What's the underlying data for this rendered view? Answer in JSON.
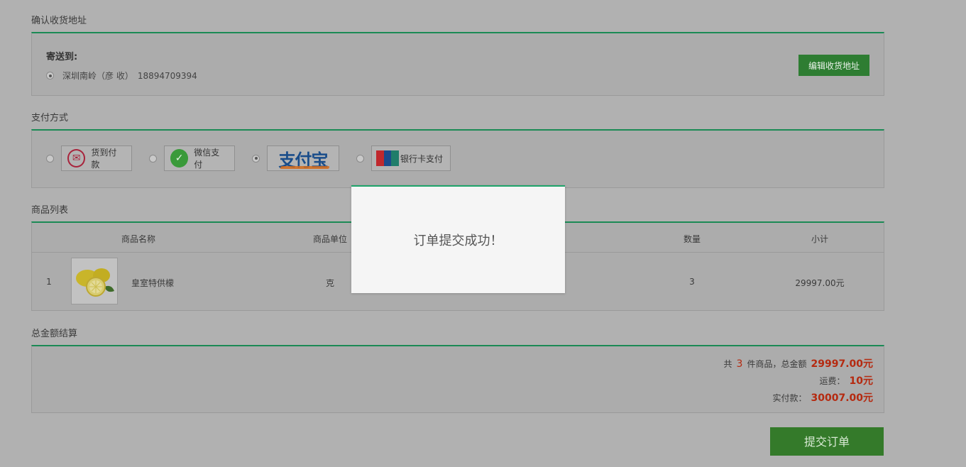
{
  "address_section": {
    "title": "确认收货地址",
    "send_to_label": "寄送到:",
    "address_text": "深圳南岭（彦 收）",
    "phone": "18894709394",
    "edit_button": "编辑收货地址"
  },
  "payment_section": {
    "title": "支付方式",
    "options": [
      {
        "label": "货到付款",
        "icon": "cash-on-delivery-icon",
        "selected": false
      },
      {
        "label": "微信支付",
        "icon": "wechat-pay-icon",
        "selected": false
      },
      {
        "label": "支付宝",
        "icon": "alipay-logo",
        "selected": true
      },
      {
        "label": "银行卡支付",
        "icon": "unionpay-icon",
        "selected": false
      }
    ]
  },
  "product_section": {
    "title": "商品列表",
    "columns": [
      "商品名称",
      "商品单位",
      "数量",
      "小计"
    ],
    "rows": [
      {
        "index": "1",
        "name": "皇室特供檬",
        "unit": "克",
        "quantity": "3",
        "subtotal": "29997.00元"
      }
    ]
  },
  "totals_section": {
    "title": "总金额结算",
    "count_prefix": "共",
    "count": "3",
    "count_suffix": "件商品，总金额",
    "total": "29997.00元",
    "shipping_label": "运费：",
    "shipping": "10元",
    "paid_label": "实付款：",
    "paid": "30007.00元"
  },
  "submit_button": "提交订单",
  "toast": {
    "message": "订单提交成功！"
  },
  "colors": {
    "accent": "#1b8a55",
    "button": "#2e7d32",
    "price": "#b52a10",
    "overlay": "#b1b1b1"
  }
}
